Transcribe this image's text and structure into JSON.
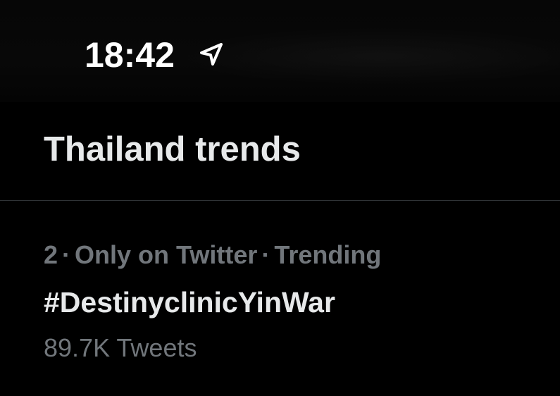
{
  "status_bar": {
    "time": "18:42",
    "location_icon": "location-arrow-icon"
  },
  "section": {
    "title": "Thailand trends"
  },
  "trends": [
    {
      "rank": "2",
      "separator": "·",
      "context": "Only on Twitter",
      "category": "Trending",
      "name": "#DestinyclinicYinWar",
      "count": "89.7K Tweets"
    }
  ],
  "colors": {
    "background": "#000000",
    "primary_text": "#e7e9ea",
    "secondary_text": "#71767b",
    "divider": "#2f3336"
  }
}
